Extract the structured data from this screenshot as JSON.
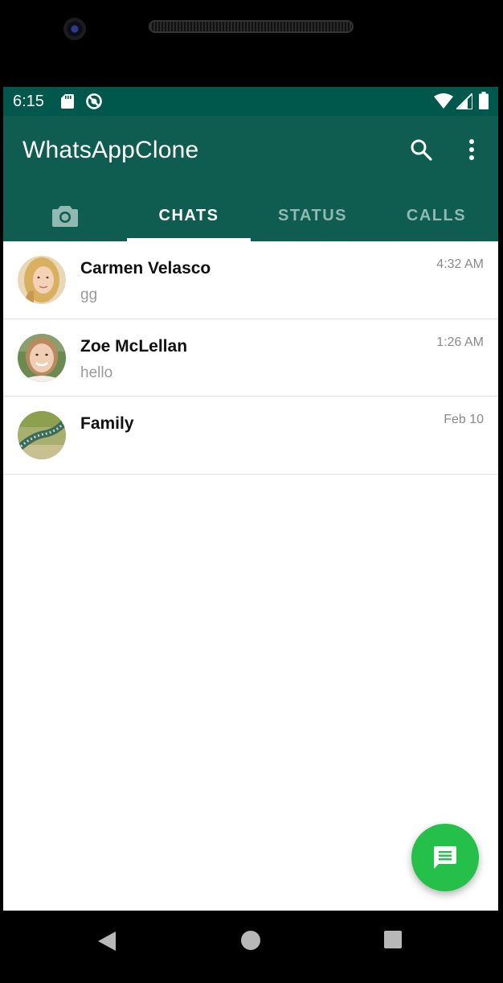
{
  "status_bar": {
    "time": "6:15",
    "icons": [
      "sd-card-icon",
      "sync-disabled-icon",
      "wifi-icon",
      "signal-icon",
      "battery-icon"
    ]
  },
  "app_bar": {
    "title": "WhatsAppClone",
    "icons": [
      "search-icon",
      "more-vert-icon"
    ]
  },
  "tabs": [
    {
      "label": "",
      "icon": "camera-icon",
      "active": false
    },
    {
      "label": "CHATS",
      "active": true
    },
    {
      "label": "STATUS",
      "active": false
    },
    {
      "label": "CALLS",
      "active": false
    }
  ],
  "chats": [
    {
      "name": "Carmen Velasco",
      "message": "gg",
      "time": "4:32 AM",
      "avatar": "avatar-photo-blonde-woman"
    },
    {
      "name": "Zoe McLellan",
      "message": "hello",
      "time": "1:26 AM",
      "avatar": "avatar-photo-smiling-woman"
    },
    {
      "name": "Family",
      "message": "",
      "time": "Feb 10",
      "avatar": "avatar-photo-caterpillar"
    }
  ],
  "fab": {
    "icon": "message-icon"
  },
  "colors": {
    "status_bar": "#00574b",
    "app_bar": "#0f5c50",
    "tab_inactive": "#8fb9b1",
    "fab": "#25c04a"
  },
  "nav_bar": {
    "icons": [
      "back-icon",
      "home-icon",
      "recents-icon"
    ]
  }
}
